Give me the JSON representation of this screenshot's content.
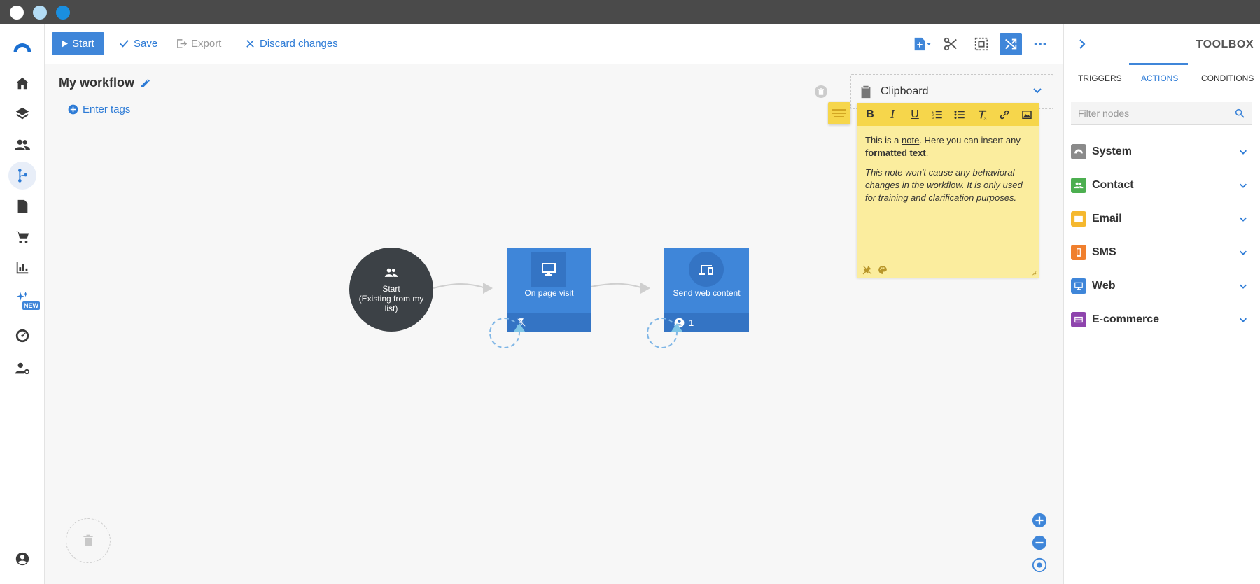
{
  "window": {
    "dots": [
      "#ffffff",
      "#b3dcf5",
      "#1a8fe0"
    ]
  },
  "toolbar": {
    "start_label": "Start",
    "save_label": "Save",
    "export_label": "Export",
    "discard_label": "Discard changes"
  },
  "workflow": {
    "title": "My workflow",
    "tags_label": "Enter tags"
  },
  "clipboard": {
    "label": "Clipboard"
  },
  "nodes": {
    "start": {
      "line1": "Start",
      "line2": "(Existing from my",
      "line3": "list)"
    },
    "page_visit": {
      "label": "On page visit"
    },
    "web_content": {
      "label": "Send web content",
      "count": "1"
    }
  },
  "note": {
    "text_pre": "This is a ",
    "text_link": "note",
    "text_mid": ". Here you can insert any ",
    "text_bold": "formatted text",
    "text_end": ".",
    "italic": "This note won't cause any behavioral changes in the workflow. It is only used for training and clarification purposes."
  },
  "nav": {
    "new_badge": "NEW"
  },
  "toolbox": {
    "title": "TOOLBOX",
    "tabs": [
      "TRIGGERS",
      "ACTIONS",
      "CONDITIONS"
    ],
    "active_tab": "ACTIONS",
    "filter_placeholder": "Filter nodes",
    "categories": [
      {
        "label": "System",
        "color": "#8a8a8a"
      },
      {
        "label": "Contact",
        "color": "#4caf50"
      },
      {
        "label": "Email",
        "color": "#f5b82e"
      },
      {
        "label": "SMS",
        "color": "#f07f2d"
      },
      {
        "label": "Web",
        "color": "#3f86d9"
      },
      {
        "label": "E-commerce",
        "color": "#8e44ad"
      }
    ]
  },
  "colors": {
    "accent": "#3f86d9",
    "note_bg": "#fbed9e",
    "note_bar": "#f6d64b",
    "start_node": "#3c4146"
  }
}
